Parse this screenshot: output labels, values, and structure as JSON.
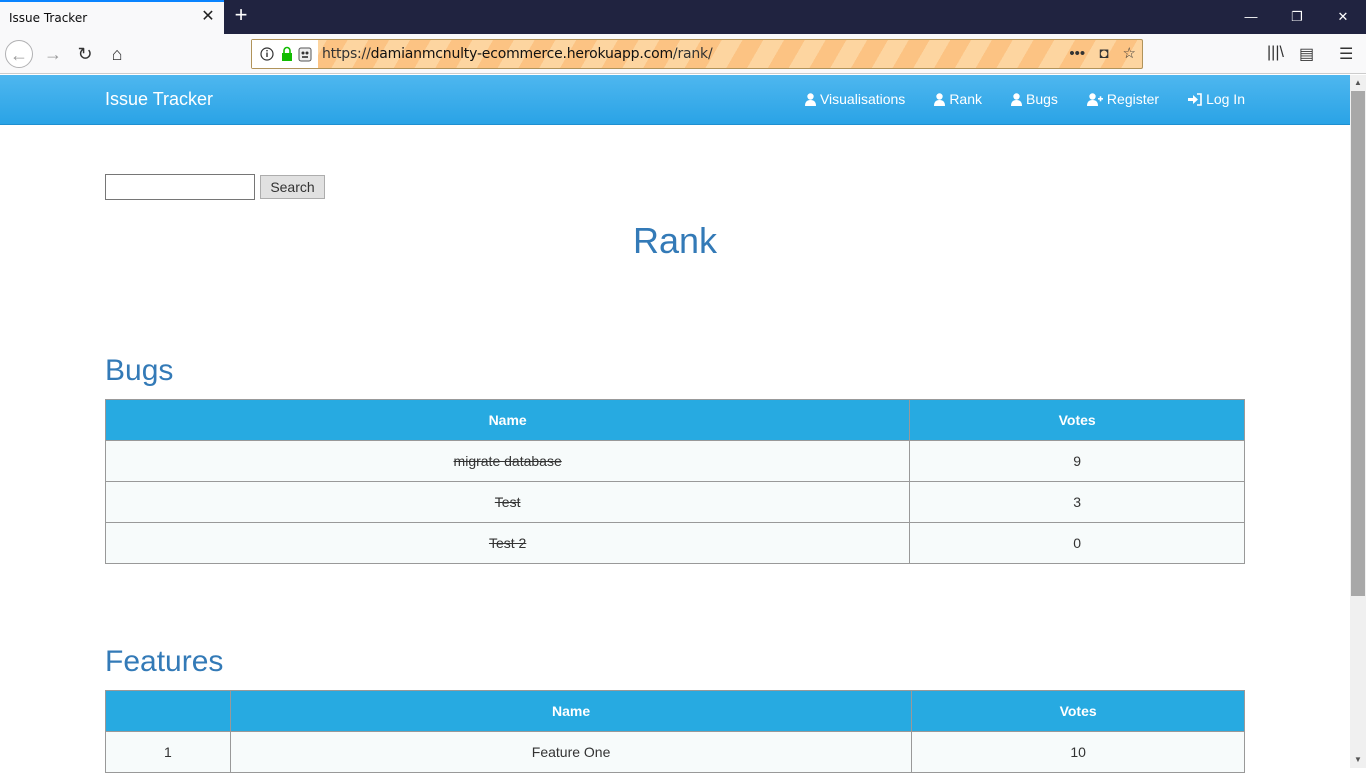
{
  "browser": {
    "tab_title": "Issue Tracker",
    "url_prefix": "https://",
    "url_host": "damianmcnulty-ecommerce.herokuapp.com",
    "url_path": "/rank/"
  },
  "site": {
    "brand": "Issue Tracker",
    "nav": [
      {
        "label": "Visualisations",
        "icon": "user-icon"
      },
      {
        "label": "Rank",
        "icon": "user-icon"
      },
      {
        "label": "Bugs",
        "icon": "user-icon"
      },
      {
        "label": "Register",
        "icon": "user-plus-icon"
      },
      {
        "label": "Log In",
        "icon": "sign-in-icon"
      }
    ]
  },
  "search": {
    "button_label": "Search",
    "value": ""
  },
  "page": {
    "heading": "Rank"
  },
  "bugs": {
    "title": "Bugs",
    "columns": [
      "Name",
      "Votes"
    ],
    "rows": [
      {
        "name": "migrate database",
        "votes": "9"
      },
      {
        "name": "Test",
        "votes": "3"
      },
      {
        "name": "Test 2",
        "votes": "0"
      }
    ]
  },
  "features": {
    "title": "Features",
    "columns": [
      "",
      "Name",
      "Votes"
    ],
    "rows": [
      {
        "rank": "1",
        "name": "Feature One",
        "votes": "10"
      }
    ]
  },
  "colors": {
    "accent": "#27aae1",
    "heading": "#337ab7"
  }
}
